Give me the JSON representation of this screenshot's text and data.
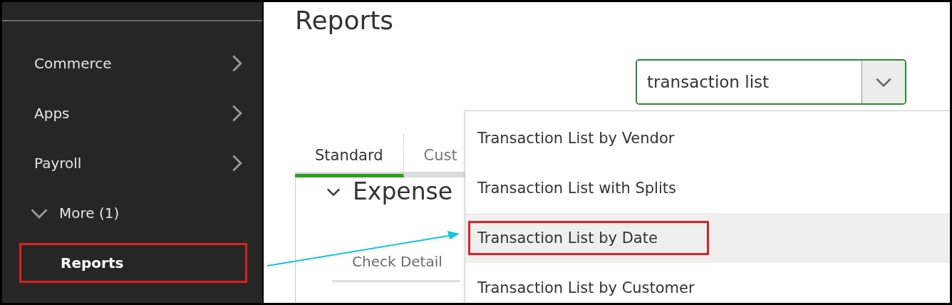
{
  "sidebar": {
    "items": [
      {
        "label": "Commerce",
        "kind": "submenu",
        "selected": false
      },
      {
        "label": "Apps",
        "kind": "submenu",
        "selected": false
      },
      {
        "label": "Payroll",
        "kind": "submenu",
        "selected": false
      },
      {
        "label": "More (1)",
        "kind": "expander",
        "expanded": true,
        "selected": false
      },
      {
        "label": "Reports",
        "kind": "child",
        "selected": true,
        "highlighted": true
      }
    ]
  },
  "main": {
    "title": "Reports",
    "search": {
      "value": "transaction list",
      "focused": true
    },
    "tabs": [
      {
        "label": "Standard",
        "selected": true
      },
      {
        "label": "Cust",
        "selected": false
      }
    ],
    "section": {
      "title": "Expense",
      "expanded": true,
      "items": [
        "Check Detail"
      ]
    },
    "dropdown": {
      "options": [
        {
          "label": "Transaction List by Vendor",
          "hovered": false,
          "highlighted": false
        },
        {
          "label": "Transaction List with Splits",
          "hovered": false,
          "highlighted": false
        },
        {
          "label": "Transaction List by Date",
          "hovered": true,
          "highlighted": true
        },
        {
          "label": "Transaction List by Customer",
          "hovered": false,
          "highlighted": false
        }
      ]
    }
  }
}
